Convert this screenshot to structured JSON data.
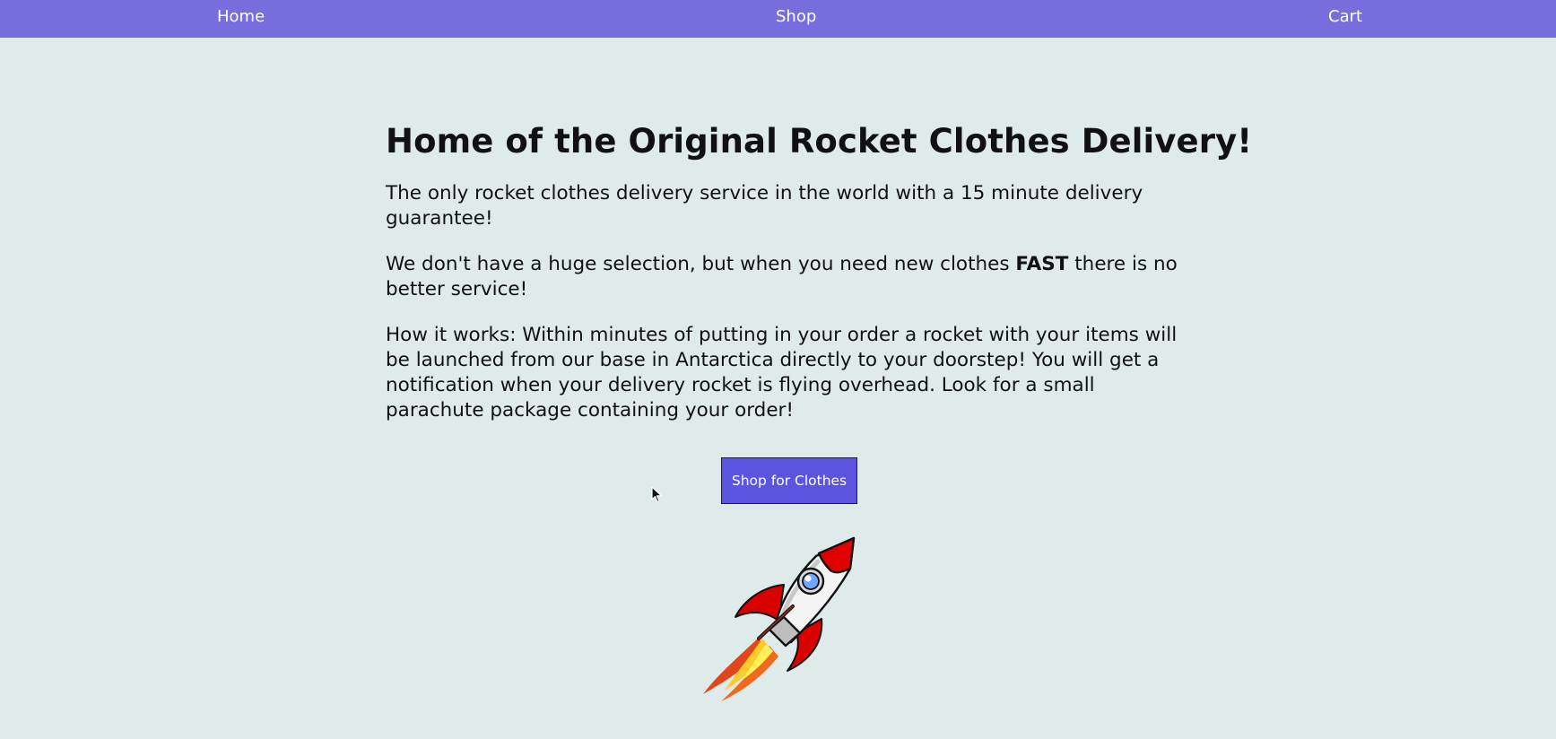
{
  "nav": {
    "home": "Home",
    "shop": "Shop",
    "cart": "Cart"
  },
  "hero": {
    "title": "Home of the Original Rocket Clothes Delivery!",
    "p1": "The only rocket clothes delivery service in the world with a 15 minute delivery guarantee!",
    "p2_before": "We don't have a huge selection, but when you need new clothes ",
    "p2_bold": "FAST",
    "p2_after": " there is no better service!",
    "p3": "How it works: Within minutes of putting in your order a rocket with your items will be launched from our base in Antarctica directly to your doorstep! You will get a notification when your delivery rocket is flying overhead. Look for a small parachute package containing your order!",
    "button_label": "Shop for Clothes"
  },
  "images": {
    "rocket": "rocket-illustration",
    "cursor": "mouse-pointer-icon"
  },
  "colors": {
    "navbar": "#756edc",
    "background": "#dfebeb",
    "button": "#5b54e0"
  }
}
